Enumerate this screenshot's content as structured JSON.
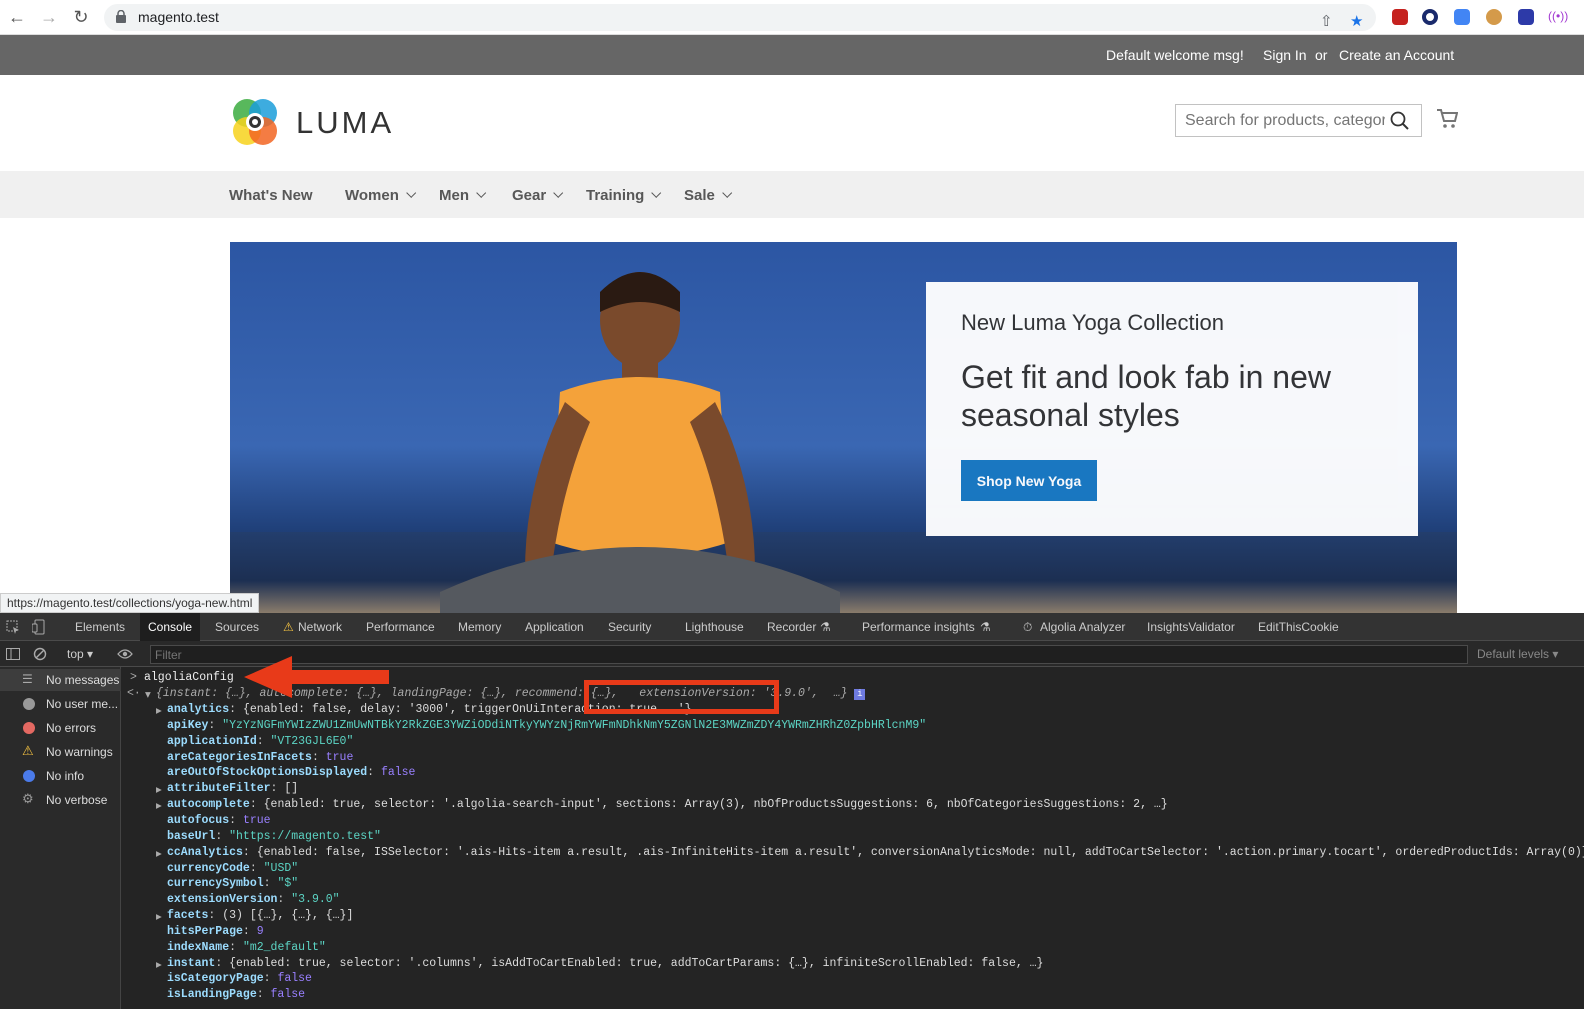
{
  "browser": {
    "url": "magento.test",
    "extension_badge": "1"
  },
  "topbar": {
    "welcome": "Default welcome msg!",
    "sign_in": "Sign In",
    "or": "or",
    "create_account": "Create an Account"
  },
  "header": {
    "logo_text": "LUMA",
    "search_placeholder": "Search for products, categories"
  },
  "nav": {
    "items": [
      "What's New",
      "Women",
      "Men",
      "Gear",
      "Training",
      "Sale"
    ]
  },
  "promo": {
    "subtitle": "New Luma Yoga Collection",
    "headline": "Get fit and look fab in new seasonal styles",
    "button": "Shop New Yoga"
  },
  "status_url": "https://magento.test/collections/yoga-new.html",
  "devtools": {
    "tabs": [
      "Elements",
      "Console",
      "Sources",
      "Network",
      "Performance",
      "Memory",
      "Application",
      "Security",
      "Lighthouse",
      "Recorder",
      "Performance insights",
      "Algolia Analyzer",
      "InsightsValidator",
      "EditThisCookie"
    ],
    "context": "top",
    "filter_placeholder": "Filter",
    "levels": "Default levels",
    "sidebar": [
      "No messages",
      "No user me...",
      "No errors",
      "No warnings",
      "No info",
      "No verbose"
    ],
    "input": "algoliaConfig",
    "summary_start": "{instant: {…}, autocomplete: {…}, landingPage: {…}, recommend: {…},",
    "summary_highlight": "extensionVersion: '3.9.0',",
    "summary_end": "…}",
    "lines": [
      {
        "key": "analytics",
        "rest": "{enabled: false, delay: '3000', triggerOnUiInteraction: true, …'}",
        "expand": true
      },
      {
        "key": "apiKey",
        "rest": "\"YzYzNGFmYWIzZWU1ZmUwNTBkY2RkZGE3YWZiODdiNTkyYWYzNjRmYWFmNDhkNmY5ZGNlN2E3MWZmZDY4YWRmZHRhZ0ZpbHRlcnM9\""
      },
      {
        "key": "applicationId",
        "rest": "\"VT23GJL6E0\""
      },
      {
        "key": "areCategoriesInFacets",
        "rest": "true"
      },
      {
        "key": "areOutOfStockOptionsDisplayed",
        "rest": "false"
      },
      {
        "key": "attributeFilter",
        "rest": "[]",
        "expand": true
      },
      {
        "key": "autocomplete",
        "rest": "{enabled: true, selector: '.algolia-search-input', sections: Array(3), nbOfProductsSuggestions: 6, nbOfCategoriesSuggestions: 2, …}",
        "expand": true
      },
      {
        "key": "autofocus",
        "rest": "true"
      },
      {
        "key": "baseUrl",
        "rest": "\"https://magento.test\""
      },
      {
        "key": "ccAnalytics",
        "rest": "{enabled: false, ISSelector: '.ais-Hits-item a.result, .ais-InfiniteHits-item a.result', conversionAnalyticsMode: null, addToCartSelector: '.action.primary.tocart', orderedProductIds: Array(0)}",
        "expand": true
      },
      {
        "key": "currencyCode",
        "rest": "\"USD\""
      },
      {
        "key": "currencySymbol",
        "rest": "\"$\""
      },
      {
        "key": "extensionVersion",
        "rest": "\"3.9.0\""
      },
      {
        "key": "facets",
        "rest": "(3) [{…}, {…}, {…}]",
        "expand": true
      },
      {
        "key": "hitsPerPage",
        "rest": "9"
      },
      {
        "key": "indexName",
        "rest": "\"m2_default\""
      },
      {
        "key": "instant",
        "rest": "{enabled: true, selector: '.columns', isAddToCartEnabled: true, addToCartParams: {…}, infiniteScrollEnabled: false, …}",
        "expand": true
      },
      {
        "key": "isCategoryPage",
        "rest": "false"
      },
      {
        "key": "isLandingPage",
        "rest": "false"
      }
    ]
  }
}
